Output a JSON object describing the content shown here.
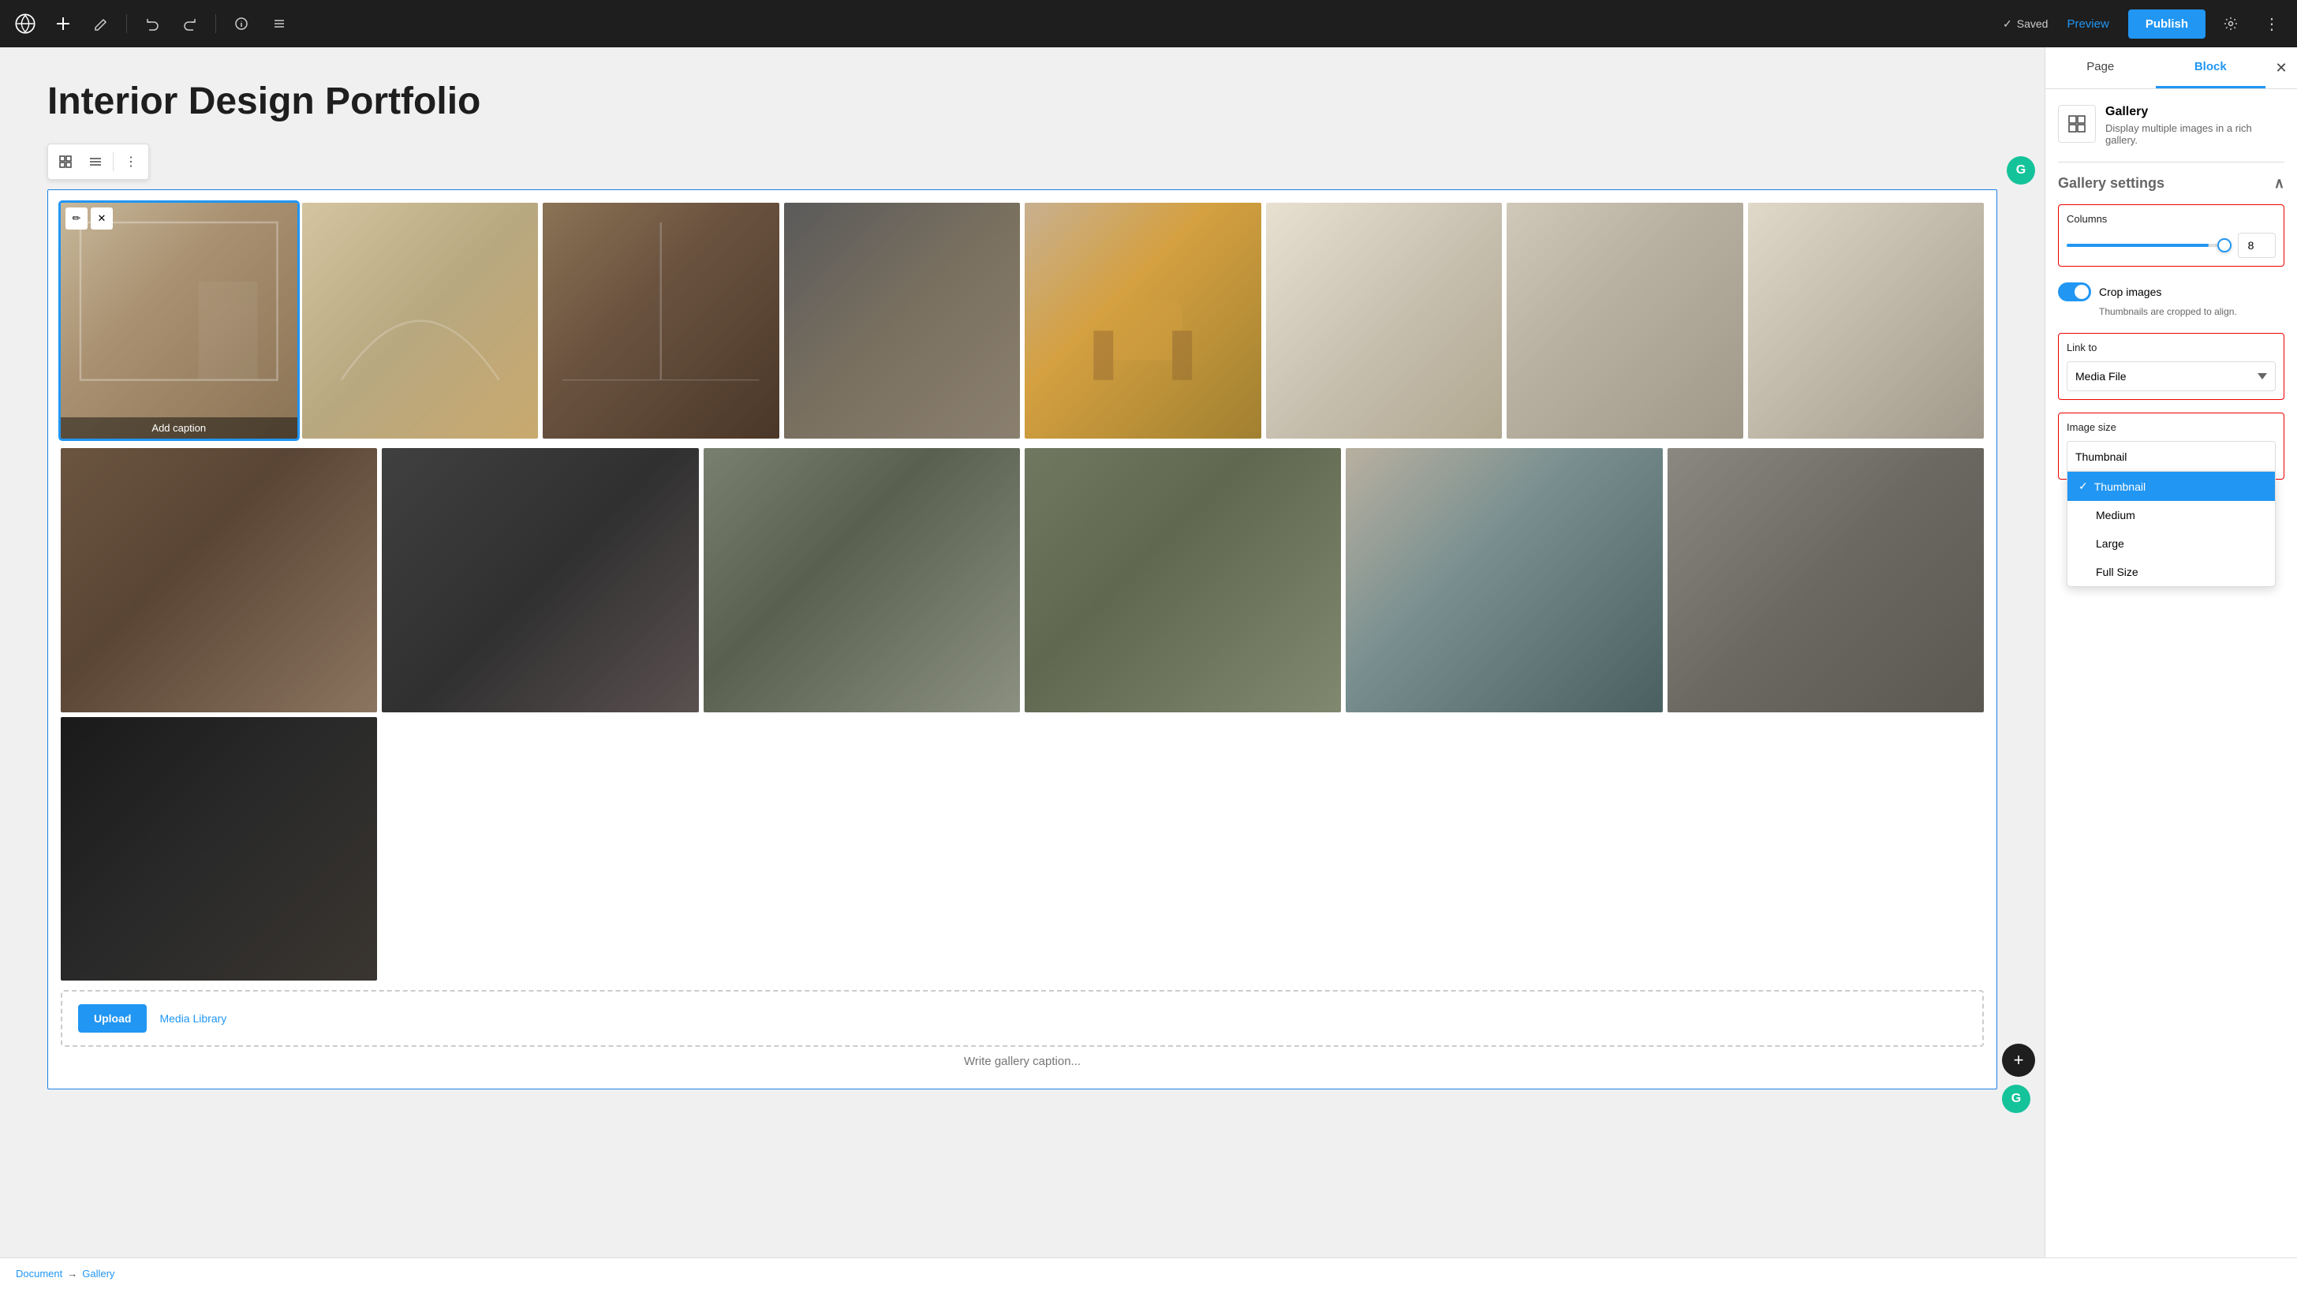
{
  "toolbar": {
    "saved_label": "Saved",
    "preview_label": "Preview",
    "publish_label": "Publish"
  },
  "editor": {
    "title": "Interior Design Portfolio",
    "gallery_caption_placeholder": "Write gallery caption...",
    "add_caption_label": "Add caption",
    "upload_label": "Upload",
    "media_library_label": "Media Library"
  },
  "status_bar": {
    "document_label": "Document",
    "separator": "→",
    "gallery_label": "Gallery"
  },
  "block_toolbar": {
    "image_icon": "🖼",
    "layout_icon": "☰",
    "more_icon": "⋮"
  },
  "right_panel": {
    "page_tab": "Page",
    "block_tab": "Block",
    "block_name": "Gallery",
    "block_desc": "Display multiple images in a rich gallery.",
    "gallery_settings_label": "Gallery settings",
    "columns_label": "Columns",
    "columns_value": "8",
    "crop_images_label": "Crop images",
    "crop_sublabel": "Thumbnails are cropped to align.",
    "link_to_label": "Link to",
    "link_to_value": "Media File",
    "image_size_label": "Image size",
    "image_size_options": [
      "Thumbnail",
      "Medium",
      "Large",
      "Full Size"
    ],
    "selected_size": "Thumbnail"
  }
}
